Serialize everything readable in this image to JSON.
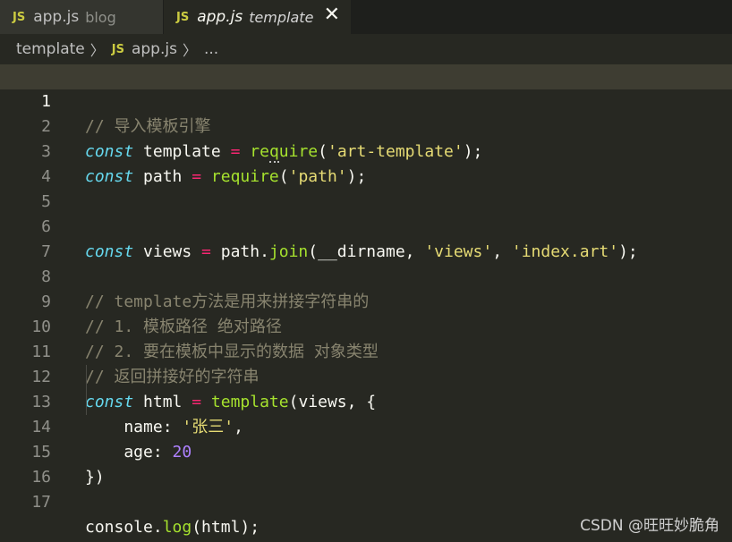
{
  "tabs": [
    {
      "badge": "JS",
      "name": "app.js",
      "desc": "blog"
    },
    {
      "badge": "JS",
      "name": "app.js",
      "desc": "template",
      "close": "✕"
    }
  ],
  "breadcrumb": {
    "folder": "template",
    "sep": "〉",
    "badge": "JS",
    "file": "app.js",
    "sep2": "〉",
    "more": "..."
  },
  "editor": {
    "line_numbers": [
      "1",
      "2",
      "3",
      "4",
      "5",
      "6",
      "7",
      "8",
      "9",
      "10",
      "11",
      "12",
      "13",
      "14",
      "15",
      "16",
      "17"
    ],
    "l1": {
      "comment": "// 导入模板引擎"
    },
    "l2": {
      "kw": "const",
      "name": " template ",
      "op": "=",
      "sp": " ",
      "fn_a": "re",
      "fn_b": "q",
      "fn_c": "uire",
      "open": "(",
      "str": "'art-template'",
      "close": ");"
    },
    "l3": {
      "kw": "const",
      "name": " path ",
      "op": "=",
      "sp": " ",
      "fn": "require",
      "open": "(",
      "str": "'path'",
      "close": ");"
    },
    "l6": {
      "kw": "const",
      "name": " views ",
      "op": "=",
      "mid": " path.",
      "fn": "join",
      "args1": "(__dirname, ",
      "str1": "'views'",
      "comma": ", ",
      "str2": "'index.art'",
      "close": ");"
    },
    "l8": {
      "comment": "// template方法是用来拼接字符串的"
    },
    "l9": {
      "comment": "// 1. 模板路径 绝对路径"
    },
    "l10": {
      "comment": "// 2. 要在模板中显示的数据 对象类型"
    },
    "l11": {
      "comment": "// 返回拼接好的字符串"
    },
    "l12": {
      "kw": "const",
      "name": " html ",
      "op": "=",
      "sp": " ",
      "fn": "template",
      "rest": "(views, {"
    },
    "l13": {
      "key": "    name: ",
      "str": "'张三'",
      "comma": ","
    },
    "l14": {
      "key": "    age: ",
      "num": "20"
    },
    "l15": {
      "text": "})"
    },
    "l17": {
      "obj": "console.",
      "fn": "log",
      "rest": "(html);"
    }
  },
  "watermark": "CSDN @旺旺妙脆角",
  "colors": {
    "background": "#272822",
    "keyword": "#66d9ef",
    "function": "#a6e22e",
    "string": "#e6db74",
    "number": "#ae81ff",
    "operator": "#f92672",
    "comment": "#88846f"
  }
}
